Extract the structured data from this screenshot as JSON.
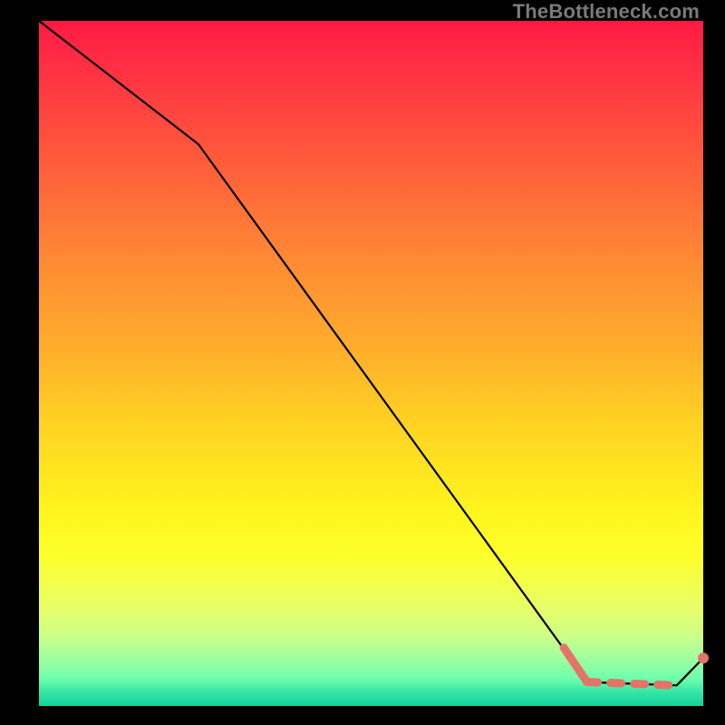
{
  "watermark": "TheBottleneck.com",
  "colors": {
    "bg": "#000000",
    "line": "#000000",
    "coral": "#e57368",
    "watermark": "#7a7a7a"
  },
  "chart_data": {
    "type": "line",
    "title": "",
    "xlabel": "",
    "ylabel": "",
    "xlim": [
      0,
      100
    ],
    "ylim": [
      0,
      100
    ],
    "grid": false,
    "legend": false,
    "series": [
      {
        "name": "bottleneck-curve",
        "style": "solid-thin-black",
        "points": [
          {
            "x": 0,
            "y": 100
          },
          {
            "x": 24,
            "y": 82
          },
          {
            "x": 80,
            "y": 7
          },
          {
            "x": 82,
            "y": 3.5
          },
          {
            "x": 96,
            "y": 3
          },
          {
            "x": 100,
            "y": 7
          }
        ]
      },
      {
        "name": "highlight-solid",
        "style": "solid-thick-coral",
        "points": [
          {
            "x": 79,
            "y": 8.5
          },
          {
            "x": 82.5,
            "y": 3.5
          }
        ]
      },
      {
        "name": "highlight-dashed",
        "style": "dashed-thick-coral",
        "points": [
          {
            "x": 82.5,
            "y": 3.5
          },
          {
            "x": 96,
            "y": 3.0
          }
        ]
      },
      {
        "name": "end-marker",
        "style": "dot-coral",
        "points": [
          {
            "x": 100,
            "y": 7
          }
        ]
      }
    ]
  }
}
